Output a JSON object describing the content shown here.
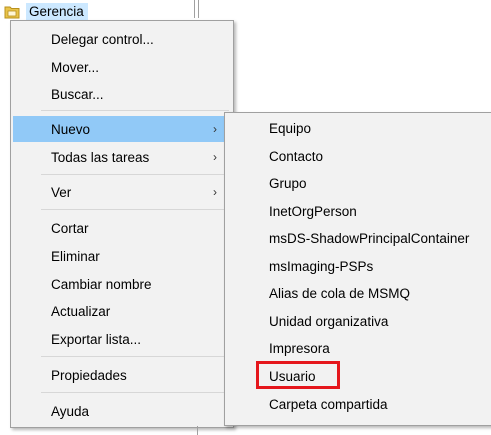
{
  "tree": {
    "node_label": "Gerencia",
    "folder_color": "#e8c34a"
  },
  "context_menu": {
    "items": [
      {
        "label": "Delegar control..."
      },
      {
        "label": "Mover..."
      },
      {
        "label": "Buscar..."
      },
      {
        "label": "Nuevo",
        "submenu": true,
        "highlighted": true
      },
      {
        "label": "Todas las tareas",
        "submenu": true
      },
      {
        "label": "Ver",
        "submenu": true
      },
      {
        "label": "Cortar"
      },
      {
        "label": "Eliminar"
      },
      {
        "label": "Cambiar nombre"
      },
      {
        "label": "Actualizar"
      },
      {
        "label": "Exportar lista..."
      },
      {
        "label": "Propiedades"
      },
      {
        "label": "Ayuda"
      }
    ],
    "arrow_glyph": "›"
  },
  "submenu_nuevo": {
    "items": [
      {
        "label": "Equipo"
      },
      {
        "label": "Contacto"
      },
      {
        "label": "Grupo"
      },
      {
        "label": "InetOrgPerson"
      },
      {
        "label": "msDS-ShadowPrincipalContainer"
      },
      {
        "label": "msImaging-PSPs"
      },
      {
        "label": "Alias de cola de MSMQ"
      },
      {
        "label": "Unidad organizativa"
      },
      {
        "label": "Impresora"
      },
      {
        "label": "Usuario",
        "annotated": true
      },
      {
        "label": "Carpeta compartida"
      }
    ]
  },
  "colors": {
    "highlight": "#91c9f7",
    "annotation_box": "#e5161c",
    "menu_bg": "#f2f2f2"
  }
}
